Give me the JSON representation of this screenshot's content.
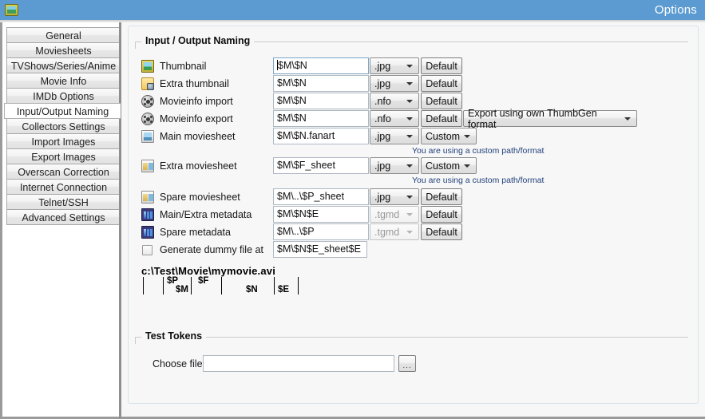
{
  "window": {
    "title": "Options",
    "app_icon": "image-app-icon"
  },
  "sidebar": {
    "items": [
      {
        "label": "General",
        "selected": false
      },
      {
        "label": "Moviesheets",
        "selected": false
      },
      {
        "label": "TVShows/Series/Anime",
        "selected": false
      },
      {
        "label": "Movie Info",
        "selected": false
      },
      {
        "label": "IMDb Options",
        "selected": false
      },
      {
        "label": "Input/Output Naming",
        "selected": true
      },
      {
        "label": "Collectors Settings",
        "selected": false
      },
      {
        "label": "Import Images",
        "selected": false
      },
      {
        "label": "Export Images",
        "selected": false
      },
      {
        "label": "Overscan Correction",
        "selected": false
      },
      {
        "label": "Internet Connection",
        "selected": false
      },
      {
        "label": "Telnet/SSH",
        "selected": false
      },
      {
        "label": "Advanced Settings",
        "selected": false
      }
    ]
  },
  "groups": {
    "naming_title": "Input / Output Naming",
    "test_title": "Test Tokens"
  },
  "rows": [
    {
      "icon": "thumbnail-icon",
      "label": "Thumbnail",
      "path": "$M\\$N",
      "ext": ".jpg",
      "ext_disabled": false,
      "mode": "Default",
      "mode_type": "button",
      "hint": ""
    },
    {
      "icon": "extra-thumbnail-icon",
      "label": "Extra thumbnail",
      "path": "$M\\$N",
      "ext": ".jpg",
      "ext_disabled": false,
      "mode": "Default",
      "mode_type": "button",
      "hint": ""
    },
    {
      "icon": "movieinfo-import-icon",
      "label": "Movieinfo import",
      "path": "$M\\$N",
      "ext": ".nfo",
      "ext_disabled": false,
      "mode": "Default",
      "mode_type": "button",
      "hint": ""
    },
    {
      "icon": "movieinfo-export-icon",
      "label": "Movieinfo export",
      "path": "$M\\$N",
      "ext": ".nfo",
      "ext_disabled": false,
      "mode": "Default",
      "mode_type": "button",
      "extra_combo": "Export using own ThumbGen format",
      "hint": ""
    },
    {
      "icon": "main-moviesheet-icon",
      "label": "Main moviesheet",
      "path": "$M\\$N.fanart",
      "ext": ".jpg",
      "ext_disabled": false,
      "mode": "Custom",
      "mode_type": "combo",
      "hint": "You are using a custom path/format"
    },
    {
      "icon": "extra-moviesheet-icon",
      "label": "Extra moviesheet",
      "path": "$M\\$F_sheet",
      "ext": ".jpg",
      "ext_disabled": false,
      "mode": "Custom",
      "mode_type": "combo",
      "hint": "You are using a custom path/format"
    },
    {
      "icon": "spare-moviesheet-icon",
      "label": "Spare moviesheet",
      "path": "$M\\..\\$P_sheet",
      "ext": ".jpg",
      "ext_disabled": false,
      "mode": "Default",
      "mode_type": "button",
      "hint": ""
    },
    {
      "icon": "main-extra-metadata-icon",
      "label": "Main/Extra metadata",
      "path": "$M\\$N$E",
      "ext": ".tgmd",
      "ext_disabled": true,
      "mode": "Default",
      "mode_type": "button",
      "hint": ""
    },
    {
      "icon": "spare-metadata-icon",
      "label": "Spare metadata",
      "path": "$M\\..\\$P",
      "ext": ".tgmd",
      "ext_disabled": true,
      "mode": "Default",
      "mode_type": "button",
      "hint": ""
    }
  ],
  "dummy_row": {
    "checkbox_checked": false,
    "label": "Generate dummy file at",
    "path": "$M\\$N$E_sheet$E"
  },
  "legend": {
    "path_example": "c:\\Test\\Movie\\mymovie.avi",
    "tokens": [
      {
        "name": "$P"
      },
      {
        "name": "$M"
      },
      {
        "name": "$F"
      },
      {
        "name": "$N"
      },
      {
        "name": "$E"
      }
    ]
  },
  "test_tokens": {
    "choose_file_label": "Choose file:",
    "choose_file_value": "",
    "browse_label": "..."
  },
  "colors": {
    "titlebar": "#5b9bd1",
    "hint_text": "#1f3f7a",
    "panel_bg": "#f7f7f7"
  }
}
